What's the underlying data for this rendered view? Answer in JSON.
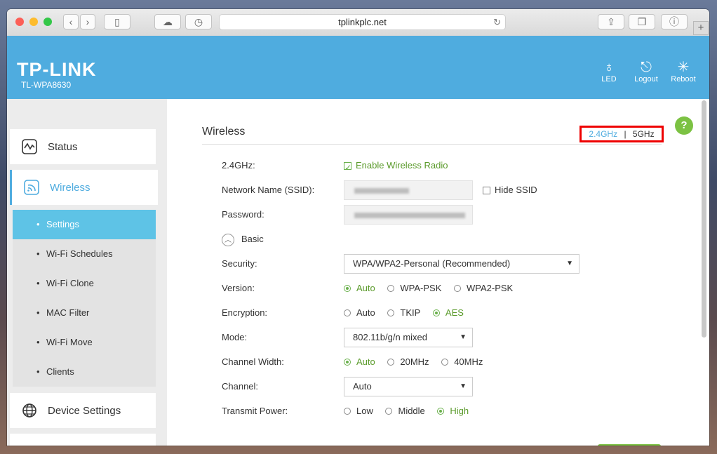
{
  "browser": {
    "url": "tplinkplc.net"
  },
  "header": {
    "logo": "TP-LINK",
    "model": "TL-WPA8630",
    "buttons": {
      "led": "LED",
      "logout": "Logout",
      "reboot": "Reboot"
    }
  },
  "sidebar": {
    "status": "Status",
    "wireless": "Wireless",
    "submenu": [
      "Settings",
      "Wi-Fi Schedules",
      "Wi-Fi Clone",
      "MAC Filter",
      "Wi-Fi Move",
      "Clients"
    ],
    "device_settings": "Device Settings"
  },
  "main": {
    "title": "Wireless",
    "band_24": "2.4GHz",
    "band_sep": "|",
    "band_5": "5GHz",
    "help": "?",
    "band_label": "2.4GHz:",
    "enable_radio": "Enable Wireless Radio",
    "ssid_label": "Network Name (SSID):",
    "hide_ssid": "Hide SSID",
    "password_label": "Password:",
    "basic": "Basic",
    "security_label": "Security:",
    "security_value": "WPA/WPA2-Personal (Recommended)",
    "version_label": "Version:",
    "version_options": [
      "Auto",
      "WPA-PSK",
      "WPA2-PSK"
    ],
    "encryption_label": "Encryption:",
    "encryption_options": [
      "Auto",
      "TKIP",
      "AES"
    ],
    "mode_label": "Mode:",
    "mode_value": "802.11b/g/n mixed",
    "width_label": "Channel Width:",
    "width_options": [
      "Auto",
      "20MHz",
      "40MHz"
    ],
    "channel_label": "Channel:",
    "channel_value": "Auto",
    "power_label": "Transmit Power:",
    "power_options": [
      "Low",
      "Middle",
      "High"
    ]
  },
  "colors": {
    "brand": "#4facdf",
    "accent_green": "#7cc243",
    "highlight_red": "#e00000"
  }
}
